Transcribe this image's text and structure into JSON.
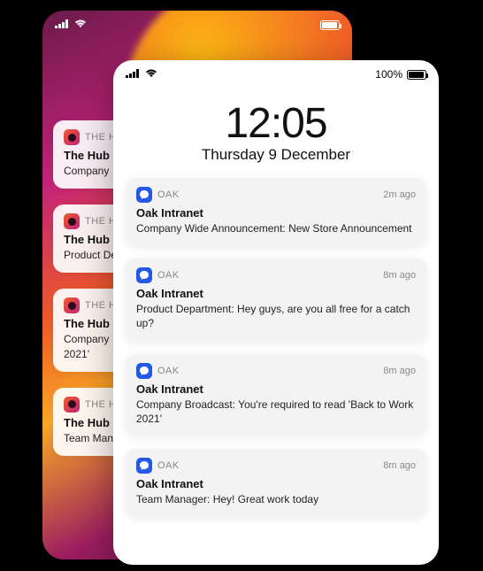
{
  "status": {
    "battery_pct": "100%"
  },
  "back_phone": {
    "app_label": "THE HUB",
    "notifications": [
      {
        "title": "The Hub",
        "body": "Company"
      },
      {
        "title": "The Hub",
        "body": "Product De"
      },
      {
        "title": "The Hub",
        "body": "Company\n2021'"
      },
      {
        "title": "The Hub",
        "body": "Team Man"
      }
    ]
  },
  "front_phone": {
    "time": "12:05",
    "date": "Thursday 9 December",
    "app_label": "OAK",
    "notifications": [
      {
        "time": "2m ago",
        "title": "Oak Intranet",
        "body": "Company Wide Announcement: New Store Announcement"
      },
      {
        "time": "8m ago",
        "title": "Oak Intranet",
        "body": "Product Department: Hey guys, are you all free for a catch up?"
      },
      {
        "time": "8m ago",
        "title": "Oak Intranet",
        "body": "Company Broadcast: You're required to read 'Back to Work 2021'"
      },
      {
        "time": "8m ago",
        "title": "Oak Intranet",
        "body": "Team Manager: Hey! Great work today"
      }
    ]
  }
}
